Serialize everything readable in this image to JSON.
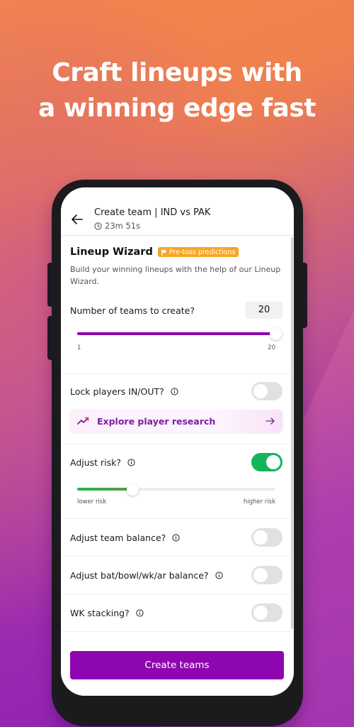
{
  "headline": {
    "line1": "Craft lineups with",
    "line2": "a winning edge fast"
  },
  "appbar": {
    "title": "Create team | IND vs PAK",
    "timer": "23m 51s"
  },
  "wizard": {
    "title": "Lineup Wizard",
    "badge": "Pre-toss predictions",
    "description": "Build your winning lineups with the help of our Lineup Wizard."
  },
  "teams_count": {
    "label": "Number of teams to create?",
    "value": "20",
    "min_label": "1",
    "max_label": "20",
    "min": 1,
    "max": 20,
    "current": 20
  },
  "lock_players": {
    "label": "Lock players IN/OUT?",
    "enabled": false
  },
  "explore": {
    "label": "Explore player research"
  },
  "risk": {
    "label": "Adjust risk?",
    "enabled": true,
    "level_fraction": 0.28,
    "low_label": "lower risk",
    "high_label": "higher risk"
  },
  "team_balance": {
    "label": "Adjust team balance?",
    "enabled": false
  },
  "role_balance": {
    "label": "Adjust bat/bowl/wk/ar balance?",
    "enabled": false
  },
  "wk_stacking": {
    "label": "WK stacking?",
    "enabled": false
  },
  "cta": {
    "label": "Create teams"
  },
  "colors": {
    "brand_purple": "#8e06b0",
    "toggle_on": "#13b45a",
    "badge": "#f7a623",
    "team_slider": "#8e06b0",
    "risk_slider": "#2fa84a"
  }
}
